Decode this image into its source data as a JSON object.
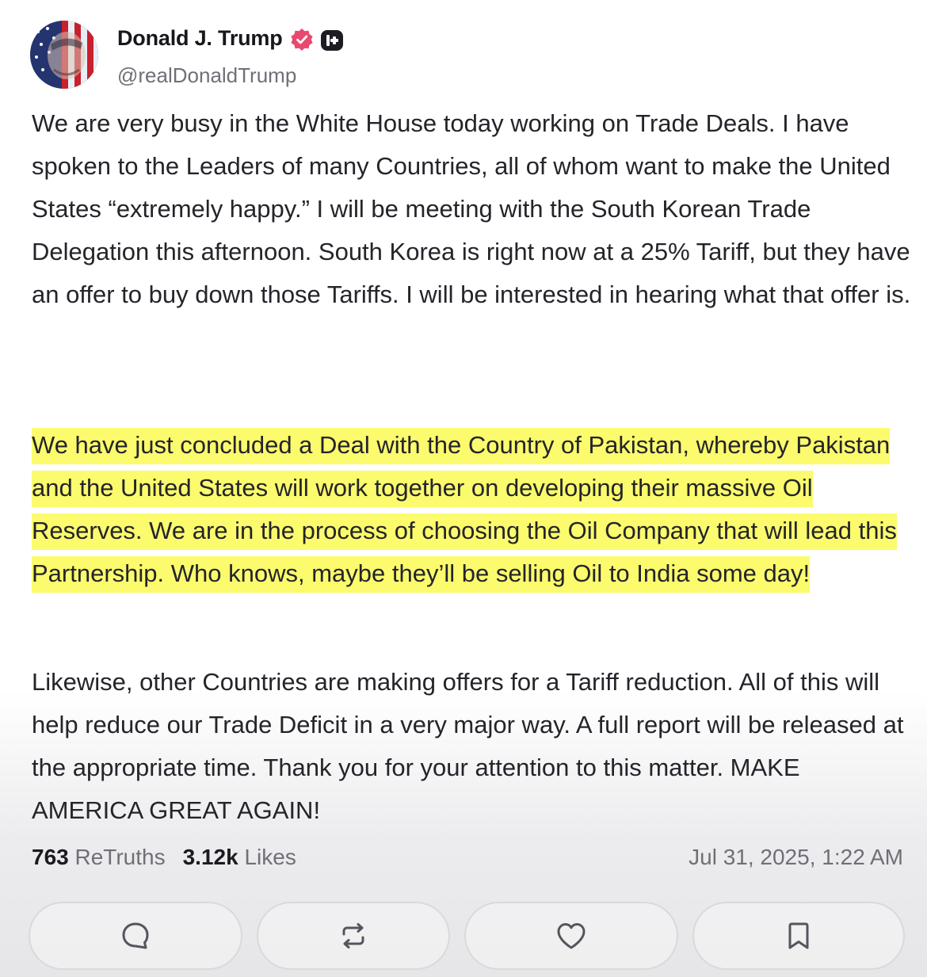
{
  "author": {
    "name": "Donald J. Trump",
    "handle": "@realDonaldTrump"
  },
  "post": {
    "paragraph_1": "We are very busy in the White House today working on Trade Deals. I have spoken to the Leaders of many Countries, all of whom want to make the United States “extremely happy.” I will be meeting with the South Korean Trade Delegation this afternoon. South Korea is right now at a 25% Tariff, but they have an offer to buy down those Tariffs. I will be interested in hearing what that offer is.",
    "paragraph_2": "We have just concluded a Deal with the Country of Pakistan, whereby Pakistan and the United States will work together on developing their massive Oil Reserves. We are in the process of choosing the Oil Company that will lead this Partnership. Who knows, maybe they’ll be selling Oil to India some day!",
    "paragraph_3": "Likewise, other Countries are making offers for a Tariff reduction. All of this will help reduce our Trade Deficit in a very major way. A full report will be released at the appropriate time. Thank you for your attention to this matter. MAKE AMERICA GREAT AGAIN!",
    "highlight_color": "#fbfb6d"
  },
  "stats": {
    "retruths_count": "763",
    "retruths_label": "ReTruths",
    "likes_count": "3.12k",
    "likes_label": "Likes",
    "timestamp": "Jul 31, 2025, 1:22 AM"
  },
  "actions": [
    {
      "icon": "reply-icon"
    },
    {
      "icon": "retruth-icon"
    },
    {
      "icon": "heart-icon"
    },
    {
      "icon": "bookmark-icon"
    }
  ],
  "colors": {
    "verified_badge": "#e8496f",
    "text": "#24242a",
    "muted": "#6f6f78"
  }
}
